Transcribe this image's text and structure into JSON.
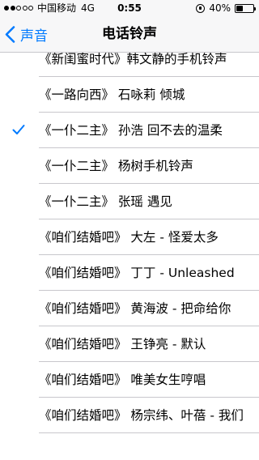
{
  "status_bar": {
    "signal_bars": 5,
    "signal_on": 2,
    "carrier": "中国移动",
    "network": "4G",
    "time": "0:55",
    "battery_text": "40%",
    "battery_level": 0.4
  },
  "nav": {
    "back_label": "声音",
    "title": "电话铃声"
  },
  "ringtones": [
    {
      "label": "《新闺蜜时代》韩文静的手机铃声",
      "checked": false
    },
    {
      "label": "《一路向西》 石咏莉 倾城",
      "checked": false
    },
    {
      "label": "《一仆二主》 孙浩 回不去的温柔",
      "checked": true
    },
    {
      "label": "《一仆二主》 杨树手机铃声",
      "checked": false
    },
    {
      "label": "《一仆二主》 张瑶 遇见",
      "checked": false
    },
    {
      "label": "《咱们结婚吧》  大左 - 怪爱太多",
      "checked": false
    },
    {
      "label": "《咱们结婚吧》  丁丁 - Unleashed",
      "checked": false
    },
    {
      "label": "《咱们结婚吧》  黄海波 - 把命给你",
      "checked": false
    },
    {
      "label": "《咱们结婚吧》  王铮亮 - 默认",
      "checked": false
    },
    {
      "label": "《咱们结婚吧》  唯美女生哼唱",
      "checked": false
    },
    {
      "label": "《咱们结婚吧》  杨宗纬、叶蓓 - 我们",
      "checked": false
    }
  ],
  "colors": {
    "accent": "#007aff",
    "separator": "#c8c7cc",
    "bar_background": "#f7f7f8"
  }
}
